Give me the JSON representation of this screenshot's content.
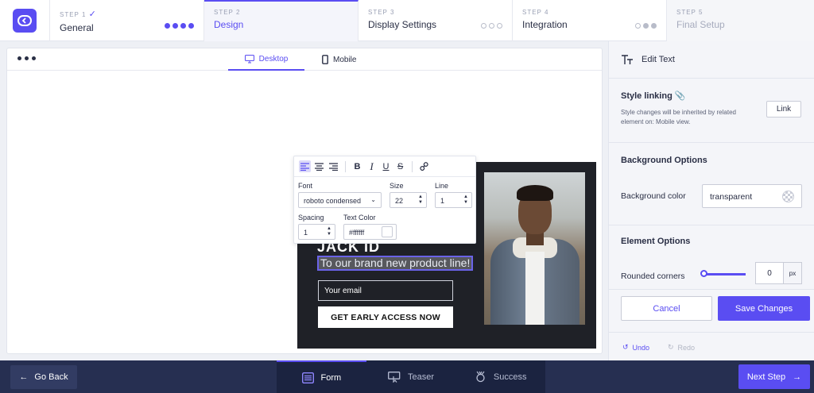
{
  "steps": [
    {
      "num": "STEP 1",
      "check": "✓",
      "name": "General"
    },
    {
      "num": "STEP 2",
      "name": "Design"
    },
    {
      "num": "STEP 3",
      "name": "Display Settings"
    },
    {
      "num": "STEP 4",
      "name": "Integration"
    },
    {
      "num": "STEP 5",
      "name": "Final Setup"
    }
  ],
  "preview": {
    "tabs": {
      "desktop": "Desktop",
      "mobile": "Mobile"
    },
    "popup": {
      "headline_fragment": "JACK ID",
      "subtext": "To our brand new product line!",
      "email_placeholder": "Your email",
      "cta": "GET EARLY ACCESS NOW"
    }
  },
  "editor": {
    "font_label": "Font",
    "font_value": "roboto condensed",
    "size_label": "Size",
    "size_value": "22",
    "line_label": "Line",
    "line_value": "1",
    "spacing_label": "Spacing",
    "spacing_value": "1",
    "color_label": "Text Color",
    "color_value": "#ffffff"
  },
  "panel": {
    "title": "Edit Text",
    "style_linking": {
      "title": "Style linking",
      "desc": "Style changes will be inherited by related element on: Mobile view.",
      "button": "Link"
    },
    "background": {
      "title": "Background Options",
      "color_label": "Background color",
      "color_value": "transparent"
    },
    "element": {
      "title": "Element Options",
      "corners_label": "Rounded corners",
      "corners_value": "0",
      "corners_unit": "px"
    },
    "cancel": "Cancel",
    "save": "Save Changes",
    "undo": "Undo",
    "redo": "Redo"
  },
  "bottom": {
    "go_back": "Go Back",
    "tabs": [
      "Form",
      "Teaser",
      "Success"
    ],
    "next": "Next Step"
  },
  "colors": {
    "accent": "#5a4df2",
    "bottom_bar": "#262f51",
    "popup_bg": "#1f2127"
  }
}
